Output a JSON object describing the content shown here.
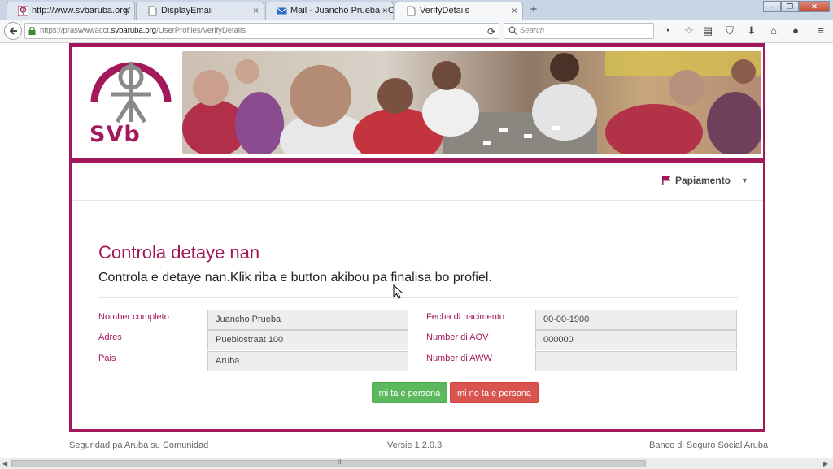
{
  "browser": {
    "tabs": [
      {
        "title": "http://www.svbaruba.org/",
        "active": false
      },
      {
        "title": "DisplayEmail",
        "active": false
      },
      {
        "title": "Mail - Juancho Prueba - O...",
        "active": false
      },
      {
        "title": "VerifyDetails",
        "active": true
      }
    ],
    "new_tab_label": "+",
    "close_glyph": "×",
    "url_prefix": "https://praswwwacct.",
    "url_domain": "svbaruba.org",
    "url_path": "/UserProfiles/VerifyDetails",
    "search_placeholder": "Search",
    "window_buttons": [
      "minimize",
      "restore",
      "close"
    ],
    "toolbar_icons": [
      "history-icon",
      "bookmark-star-icon",
      "reading-list-icon",
      "pocket-icon",
      "download-icon",
      "home-icon",
      "chat-icon",
      "menu-icon"
    ]
  },
  "site": {
    "logo_text": "SVb",
    "brand_color": "#a2185a",
    "language": "Papiamento"
  },
  "main": {
    "title": "Controla detaye nan",
    "subtitle": "Controla e detaye nan.Klik riba e button akibou pa finalisa bo profiel.",
    "fields_left": [
      {
        "label": "Nomber completo",
        "value": "Juancho Prueba"
      },
      {
        "label": "Adres",
        "value": "Pueblostraat 100"
      },
      {
        "label": "Pais",
        "value": "Aruba"
      }
    ],
    "fields_right": [
      {
        "label": "Fecha di nacimento",
        "value": "00-00-1900"
      },
      {
        "label": "Number di AOV",
        "value": "000000"
      },
      {
        "label": "Number di AWW",
        "value": ""
      }
    ],
    "confirm_button": "mi ta e persona",
    "deny_button": "mi no ta e persona"
  },
  "footer": {
    "left": "Seguridad pa Aruba su Comunidad",
    "center": "Versie 1.2.0.3",
    "right": "Banco di Seguro Social Aruba"
  },
  "scrollbar": {
    "grip": "III"
  }
}
